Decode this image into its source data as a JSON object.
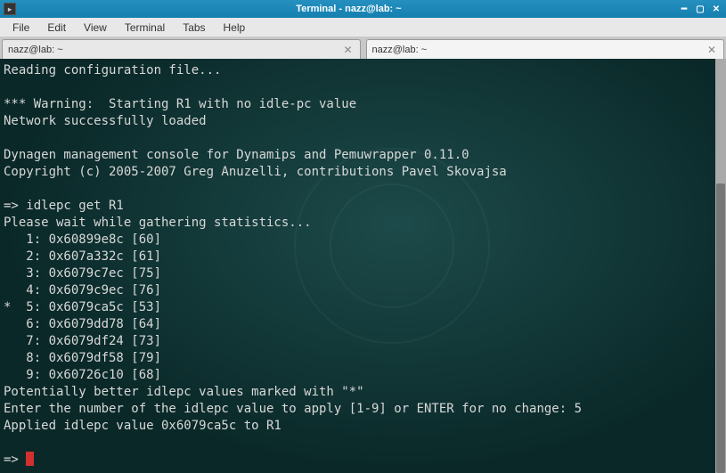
{
  "window": {
    "title": "Terminal - nazz@lab: ~"
  },
  "menu": {
    "file": "File",
    "edit": "Edit",
    "view": "View",
    "terminal": "Terminal",
    "tabs": "Tabs",
    "help": "Help"
  },
  "tabs": [
    {
      "label": "nazz@lab: ~"
    },
    {
      "label": "nazz@lab: ~"
    }
  ],
  "terminal": {
    "lines": [
      "Reading configuration file...",
      "",
      "*** Warning:  Starting R1 with no idle-pc value",
      "Network successfully loaded",
      "",
      "Dynagen management console for Dynamips and Pemuwrapper 0.11.0",
      "Copyright (c) 2005-2007 Greg Anuzelli, contributions Pavel Skovajsa",
      "",
      "=> idlepc get R1",
      "Please wait while gathering statistics...",
      "   1: 0x60899e8c [60]",
      "   2: 0x607a332c [61]",
      "   3: 0x6079c7ec [75]",
      "   4: 0x6079c9ec [76]",
      "*  5: 0x6079ca5c [53]",
      "   6: 0x6079dd78 [64]",
      "   7: 0x6079df24 [73]",
      "   8: 0x6079df58 [79]",
      "   9: 0x60726c10 [68]",
      "Potentially better idlepc values marked with \"*\"",
      "Enter the number of the idlepc value to apply [1-9] or ENTER for no change: 5",
      "Applied idlepc value 0x6079ca5c to R1",
      "",
      "=> "
    ]
  }
}
